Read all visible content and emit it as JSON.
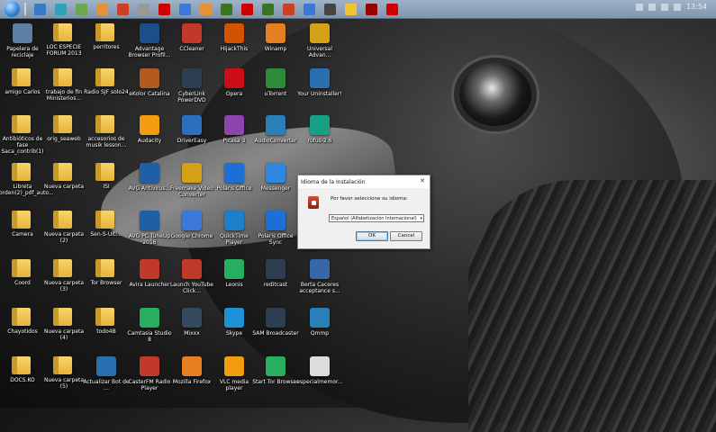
{
  "taskbar": {
    "start_icon": "windows-start-orb",
    "icons": [
      {
        "name": "blue-app",
        "color": "#3a78c8"
      },
      {
        "name": "teal-app",
        "color": "#2aa5b5"
      },
      {
        "name": "green-app",
        "color": "#6aa84f"
      },
      {
        "name": "orange-app",
        "color": "#e69138"
      },
      {
        "name": "red-app",
        "color": "#cc4125"
      },
      {
        "name": "gray-app",
        "color": "#999999"
      },
      {
        "name": "opera-app",
        "color": "#cc0000"
      },
      {
        "name": "chrome-app",
        "color": "#3c78d8"
      },
      {
        "name": "paint-app",
        "color": "#e69138"
      },
      {
        "name": "green2-app",
        "color": "#38761d"
      },
      {
        "name": "red2-app",
        "color": "#cc0000"
      },
      {
        "name": "excel-app",
        "color": "#38761d"
      },
      {
        "name": "powerpoint-app",
        "color": "#cc4125"
      },
      {
        "name": "word-app",
        "color": "#3c78d8"
      },
      {
        "name": "dark-app",
        "color": "#444444"
      },
      {
        "name": "folder-app",
        "color": "#f1c232"
      },
      {
        "name": "red3-app",
        "color": "#990000"
      },
      {
        "name": "red4-app",
        "color": "#cc0000"
      }
    ],
    "clock": "13:54"
  },
  "desktop": {
    "icons": [
      {
        "label": "Papelera de reciclaje",
        "type": "recycle",
        "color": "#5d7fa3"
      },
      {
        "label": "LOC ESPECIE FORUM 2013",
        "type": "folder"
      },
      {
        "label": "perritores",
        "type": "folder"
      },
      {
        "label": "Advantage Browser Profil...",
        "type": "app",
        "color": "#1c4e8a"
      },
      {
        "label": "CCleaner",
        "type": "app",
        "color": "#c0392b"
      },
      {
        "label": "HijackThis",
        "type": "app",
        "color": "#d35400"
      },
      {
        "label": "Winamp",
        "type": "app",
        "color": "#e67e22"
      },
      {
        "label": "Universal Advan...",
        "type": "app",
        "color": "#d4a017"
      },
      {
        "label": "amigo Carlos",
        "type": "folder"
      },
      {
        "label": "trabajo de fin Ministerios...",
        "type": "folder"
      },
      {
        "label": "Radio SJF solo24",
        "type": "folder"
      },
      {
        "label": "eKolor Catalina",
        "type": "app",
        "color": "#b35a1f"
      },
      {
        "label": "CyberLink PowerDVD",
        "type": "app",
        "color": "#2c3e50"
      },
      {
        "label": "Opera",
        "type": "app",
        "color": "#cc0f16"
      },
      {
        "label": "uTorrent",
        "type": "app",
        "color": "#2e8b3a"
      },
      {
        "label": "Your Uninstaller!",
        "type": "app",
        "color": "#2a6fb0"
      },
      {
        "label": "Antibióticos de fase Saca_contrib(1)",
        "type": "folder"
      },
      {
        "label": "orig_seaweb",
        "type": "folder"
      },
      {
        "label": "accesorios de musik lesson...",
        "type": "folder"
      },
      {
        "label": "Audacity",
        "type": "app",
        "color": "#f39c12"
      },
      {
        "label": "DriverEasy",
        "type": "app",
        "color": "#2c6fbf"
      },
      {
        "label": "Picasa 3",
        "type": "app",
        "color": "#8e44ad"
      },
      {
        "label": "AudioConverter",
        "type": "app",
        "color": "#2980b9"
      },
      {
        "label": "rufus-2.6",
        "type": "app",
        "color": "#16a085"
      },
      {
        "label": "Libreta orden(2)_pdf_auto...",
        "type": "folder"
      },
      {
        "label": "Nueva carpeta",
        "type": "folder"
      },
      {
        "label": "ISI",
        "type": "folder"
      },
      {
        "label": "AVG Antivirus...",
        "type": "app",
        "color": "#1f5fa6"
      },
      {
        "label": "Freemake Video Converter",
        "type": "app",
        "color": "#d4a017"
      },
      {
        "label": "Polaris Office",
        "type": "app",
        "color": "#1d6fd8"
      },
      {
        "label": "Messenger",
        "type": "app",
        "color": "#2e86de"
      },
      {
        "label": "Camera",
        "type": "folder"
      },
      {
        "label": "Nueva carpeta (2)",
        "type": "folder"
      },
      {
        "label": "Sen-S-Ulti...",
        "type": "folder"
      },
      {
        "label": "AVG PC TuneUp 2016",
        "type": "app",
        "color": "#1f5fa6"
      },
      {
        "label": "Google Chrome",
        "type": "app",
        "color": "#3c78d8"
      },
      {
        "label": "QuickTime Player",
        "type": "app",
        "color": "#1d7ec9"
      },
      {
        "label": "Polaris Office Sync",
        "type": "app",
        "color": "#1d6fd8"
      },
      {
        "label": "Coord",
        "type": "folder"
      },
      {
        "label": "Nueva carpeta (3)",
        "type": "folder"
      },
      {
        "label": "Tor Browser",
        "type": "folder"
      },
      {
        "label": "Avira Launcher",
        "type": "app",
        "color": "#c0392b"
      },
      {
        "label": "Launch YouTube Click...",
        "type": "app",
        "color": "#c0392b"
      },
      {
        "label": "Leonis",
        "type": "app",
        "color": "#27ae60"
      },
      {
        "label": "reditcast",
        "type": "app",
        "color": "#2c3e50"
      },
      {
        "label": "Berta Caceres acceptance s...",
        "type": "app",
        "color": "#3867a8"
      },
      {
        "label": "Chayotidos",
        "type": "folder"
      },
      {
        "label": "Nueva carpeta (4)",
        "type": "folder"
      },
      {
        "label": "todo4B",
        "type": "folder"
      },
      {
        "label": "Camtasia Studio 8",
        "type": "app",
        "color": "#27ae60"
      },
      {
        "label": "Mixxx",
        "type": "app",
        "color": "#34495e"
      },
      {
        "label": "Skype",
        "type": "app",
        "color": "#1e90d6"
      },
      {
        "label": "SAM Broadcaster",
        "type": "app",
        "color": "#2c3e50"
      },
      {
        "label": "Qmmp",
        "type": "app",
        "color": "#2980b9"
      },
      {
        "label": "DOCS.KO",
        "type": "folder"
      },
      {
        "label": "Nueva carpeta (5)",
        "type": "folder"
      },
      {
        "label": "Actualizar Bot de ...",
        "type": "app",
        "color": "#2a6fb0"
      },
      {
        "label": "CasterFM Radio Player",
        "type": "app",
        "color": "#c0392b"
      },
      {
        "label": "Mozilla Firefox",
        "type": "app",
        "color": "#e67e22"
      },
      {
        "label": "VLC media player",
        "type": "app",
        "color": "#f39c12"
      },
      {
        "label": "Start Tor Browser",
        "type": "app",
        "color": "#27ae60"
      },
      {
        "label": "especialmemor...",
        "type": "app",
        "color": "#dcdcdc"
      }
    ]
  },
  "dialog": {
    "title": "Idioma de la Instalación",
    "prompt": "Por favor seleccione su idioma:",
    "selected_language": "Español (Alfabetización Internacional)",
    "ok_label": "OK",
    "cancel_label": "Cancel",
    "close_glyph": "✕",
    "dropdown_glyph": "▾"
  }
}
